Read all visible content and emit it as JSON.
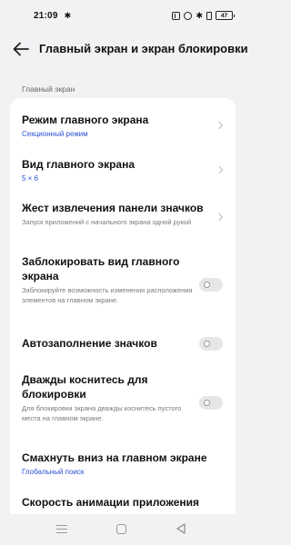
{
  "status_bar": {
    "time": "21:09",
    "battery": "47"
  },
  "header": {
    "title": "Главный экран и экран блокировки"
  },
  "section": {
    "header": "Главный экран"
  },
  "items": [
    {
      "title": "Режим главного экрана",
      "value": "Секционный режим",
      "control": "chevron"
    },
    {
      "title": "Вид главного экрана",
      "value": "5 × 6",
      "control": "chevron"
    },
    {
      "title": "Жест извлечения панели значков",
      "description": "Запуск приложений с начального экрана одной рукой",
      "control": "chevron"
    },
    {
      "title": "Заблокировать вид главного экрана",
      "description": "Заблокируйте возможность изменения расположения элементов на главном экране.",
      "control": "toggle",
      "on": false
    },
    {
      "title": "Автозаполнение значков",
      "control": "toggle",
      "on": false
    },
    {
      "title": "Дважды коснитесь для блокировки",
      "description": "Для блокировки экрана дважды коснитесь пустого места на главном экране.",
      "control": "toggle",
      "on": false
    },
    {
      "title": "Смахнуть вниз на главном экране",
      "value": "Глобальный поиск",
      "control": "none"
    },
    {
      "title": "Скорость анимации приложения",
      "control": "none"
    }
  ],
  "colors": {
    "accent": "#2a4fd6",
    "background": "#f2f2f5",
    "card": "#ffffff"
  }
}
